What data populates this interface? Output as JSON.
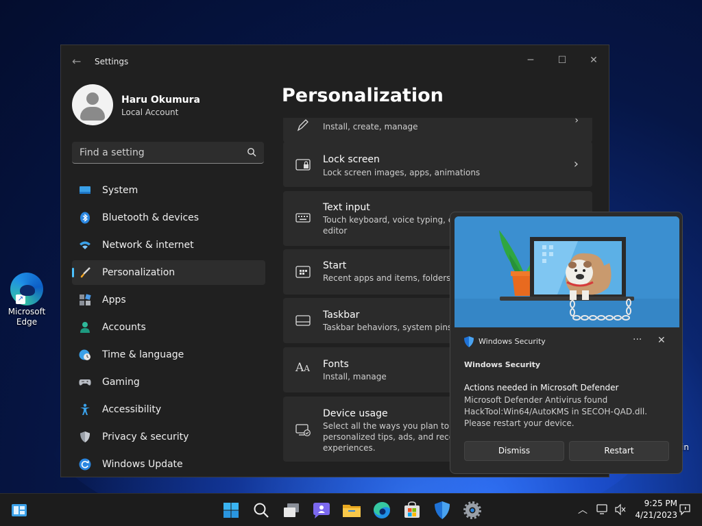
{
  "desktop": {
    "edge_label": "Microsoft Edge",
    "partial_label": "in"
  },
  "settings": {
    "app_title": "Settings",
    "user": {
      "name": "Haru Okumura",
      "account": "Local Account"
    },
    "search": {
      "placeholder": "Find a setting"
    },
    "nav": [
      {
        "label": "System",
        "icon": "monitor-icon"
      },
      {
        "label": "Bluetooth & devices",
        "icon": "bluetooth-icon"
      },
      {
        "label": "Network & internet",
        "icon": "wifi-icon"
      },
      {
        "label": "Personalization",
        "icon": "brush-icon",
        "active": true
      },
      {
        "label": "Apps",
        "icon": "apps-icon"
      },
      {
        "label": "Accounts",
        "icon": "person-icon"
      },
      {
        "label": "Time & language",
        "icon": "globe-clock-icon"
      },
      {
        "label": "Gaming",
        "icon": "gamepad-icon"
      },
      {
        "label": "Accessibility",
        "icon": "accessibility-icon"
      },
      {
        "label": "Privacy & security",
        "icon": "shield-icon"
      },
      {
        "label": "Windows Update",
        "icon": "update-icon"
      }
    ],
    "page_title": "Personalization",
    "cards": [
      {
        "title": "",
        "sub": "Install, create, manage",
        "icon": "pen-icon"
      },
      {
        "title": "Lock screen",
        "sub": "Lock screen images, apps, animations",
        "icon": "lock-screen-icon"
      },
      {
        "title": "Text input",
        "sub": "Touch keyboard, voice typing, emoj",
        "sub2": "editor",
        "icon": "keyboard-icon"
      },
      {
        "title": "Start",
        "sub": "Recent apps and items, folders",
        "icon": "start-icon"
      },
      {
        "title": "Taskbar",
        "sub": "Taskbar behaviors, system pins",
        "icon": "taskbar-icon"
      },
      {
        "title": "Fonts",
        "sub": "Install, manage",
        "icon": "fonts-icon"
      },
      {
        "title": "Device usage",
        "sub": "Select all the ways you plan to use",
        "sub2": "personalized tips, ads, and recomm",
        "sub3": "experiences.",
        "icon": "device-usage-icon"
      }
    ]
  },
  "toast": {
    "app_name": "Windows Security",
    "sender": "Windows Security",
    "headline": "Actions needed in Microsoft Defender",
    "body": "Microsoft Defender Antivirus found HackTool:Win64/AutoKMS in SECOH-QAD.dll. Please restart your device.",
    "more": "···",
    "close": "✕",
    "buttons": {
      "dismiss": "Dismiss",
      "restart": "Restart"
    }
  },
  "taskbar": {
    "time": "9:25 PM",
    "date": "4/21/2023"
  },
  "colors": {
    "accent": "#4cc2ff",
    "window_bg": "#202020",
    "card_bg": "#2b2b2b"
  }
}
